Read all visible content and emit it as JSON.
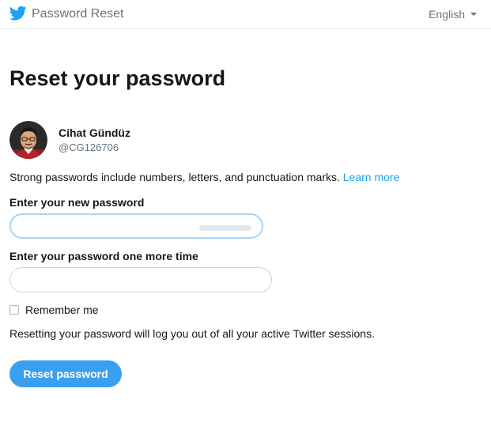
{
  "header": {
    "title": "Password Reset",
    "language": "English",
    "logo_icon": "twitter-bird-icon",
    "brand_color": "#1da1f2"
  },
  "main": {
    "title": "Reset your password",
    "user": {
      "name": "Cihat Gündüz",
      "handle": "@CG126706"
    },
    "hint_text": "Strong passwords include numbers, letters, and punctuation marks.",
    "learn_more_label": "Learn more",
    "new_password_label": "Enter your new password",
    "new_password_value": "",
    "confirm_password_label": "Enter your password one more time",
    "confirm_password_value": "",
    "remember_me_label": "Remember me",
    "remember_me_checked": false,
    "notice": "Resetting your password will log you out of all your active Twitter sessions.",
    "reset_button_label": "Reset password",
    "button_color": "#3b9ff0"
  }
}
